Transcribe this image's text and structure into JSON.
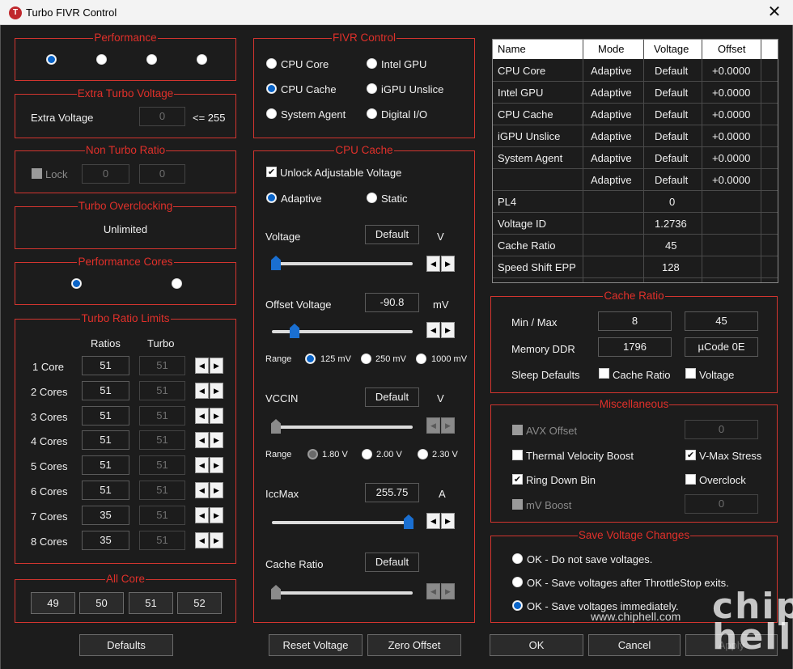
{
  "window": {
    "title": "Turbo FIVR Control",
    "icon_letter": "T",
    "close_glyph": "✕"
  },
  "performance": {
    "legend": "Performance",
    "selected": 0
  },
  "extra_turbo": {
    "legend": "Extra Turbo Voltage",
    "label": "Extra Voltage",
    "value": "0",
    "max_text": "<= 255"
  },
  "non_turbo": {
    "legend": "Non Turbo Ratio",
    "lock_label": "Lock",
    "value1": "0",
    "value2": "0"
  },
  "turbo_oc": {
    "legend": "Turbo Overclocking",
    "status": "Unlimited"
  },
  "perf_cores": {
    "legend": "Performance Cores",
    "selected": 0
  },
  "turbo_ratio": {
    "legend": "Turbo Ratio Limits",
    "col_ratios": "Ratios",
    "col_turbo": "Turbo",
    "rows": [
      {
        "label": "1 Core",
        "ratio": "51",
        "turbo": "51"
      },
      {
        "label": "2 Cores",
        "ratio": "51",
        "turbo": "51"
      },
      {
        "label": "3 Cores",
        "ratio": "51",
        "turbo": "51"
      },
      {
        "label": "4 Cores",
        "ratio": "51",
        "turbo": "51"
      },
      {
        "label": "5 Cores",
        "ratio": "51",
        "turbo": "51"
      },
      {
        "label": "6 Cores",
        "ratio": "51",
        "turbo": "51"
      },
      {
        "label": "7 Cores",
        "ratio": "35",
        "turbo": "51"
      },
      {
        "label": "8 Cores",
        "ratio": "35",
        "turbo": "51"
      }
    ]
  },
  "all_core": {
    "legend": "All Core",
    "values": [
      "49",
      "50",
      "51",
      "52"
    ]
  },
  "fivr_control": {
    "legend": "FIVR Control",
    "options": [
      "CPU Core",
      "Intel GPU",
      "CPU Cache",
      "iGPU Unslice",
      "System Agent",
      "Digital I/O"
    ],
    "selected": "CPU Cache"
  },
  "cpu_cache": {
    "legend": "CPU Cache",
    "unlock_label": "Unlock Adjustable Voltage",
    "unlock_checked": true,
    "mode_adaptive": "Adaptive",
    "mode_static": "Static",
    "voltage_label": "Voltage",
    "voltage_value": "Default",
    "voltage_unit": "V",
    "offset_label": "Offset Voltage",
    "offset_value": "-90.8",
    "offset_unit": "mV",
    "range_label": "Range",
    "offset_ranges": [
      "125 mV",
      "250 mV",
      "1000 mV"
    ],
    "vccin_label": "VCCIN",
    "vccin_value": "Default",
    "vccin_unit": "V",
    "vccin_ranges": [
      "1.80 V",
      "2.00 V",
      "2.30 V"
    ],
    "iccmax_label": "IccMax",
    "iccmax_value": "255.75",
    "iccmax_unit": "A",
    "cache_ratio_label": "Cache Ratio",
    "cache_ratio_value": "Default"
  },
  "table": {
    "headers": [
      "Name",
      "Mode",
      "Voltage",
      "Offset"
    ],
    "rows": [
      [
        "CPU Core",
        "Adaptive",
        "Default",
        "+0.0000"
      ],
      [
        "Intel GPU",
        "Adaptive",
        "Default",
        "+0.0000"
      ],
      [
        "CPU Cache",
        "Adaptive",
        "Default",
        "+0.0000"
      ],
      [
        "iGPU Unslice",
        "Adaptive",
        "Default",
        "+0.0000"
      ],
      [
        "System Agent",
        "Adaptive",
        "Default",
        "+0.0000"
      ],
      [
        "",
        "Adaptive",
        "Default",
        "+0.0000"
      ],
      [
        "PL4",
        "",
        "0",
        ""
      ],
      [
        "Voltage ID",
        "",
        "1.2736",
        ""
      ],
      [
        "Cache Ratio",
        "",
        "45",
        ""
      ],
      [
        "Speed Shift EPP",
        "",
        "128",
        ""
      ]
    ]
  },
  "cache_ratio": {
    "legend": "Cache Ratio",
    "minmax_label": "Min / Max",
    "min": "8",
    "max": "45",
    "memory_label": "Memory DDR",
    "memory_value": "1796",
    "ucode": "µCode  0E",
    "sleep_label": "Sleep Defaults",
    "sleep_cache_ratio": "Cache Ratio",
    "sleep_voltage": "Voltage"
  },
  "misc": {
    "legend": "Miscellaneous",
    "avx_offset": "AVX Offset",
    "avx_value": "0",
    "tvb": "Thermal Velocity Boost",
    "vmax": "V-Max Stress",
    "ring_down": "Ring Down Bin",
    "overclock": "Overclock",
    "mv_boost": "mV Boost",
    "mv_value": "0"
  },
  "save": {
    "legend": "Save Voltage Changes",
    "options": [
      "OK - Do not save voltages.",
      "OK - Save voltages after ThrottleStop exits.",
      "OK - Save voltages immediately."
    ],
    "selected": 2
  },
  "buttons": {
    "defaults": "Defaults",
    "reset_voltage": "Reset Voltage",
    "zero_offset": "Zero Offset",
    "ok": "OK",
    "cancel": "Cancel",
    "apply": "Apply"
  },
  "watermark": {
    "logo": "chip hell",
    "url": "www.chiphell.com"
  }
}
